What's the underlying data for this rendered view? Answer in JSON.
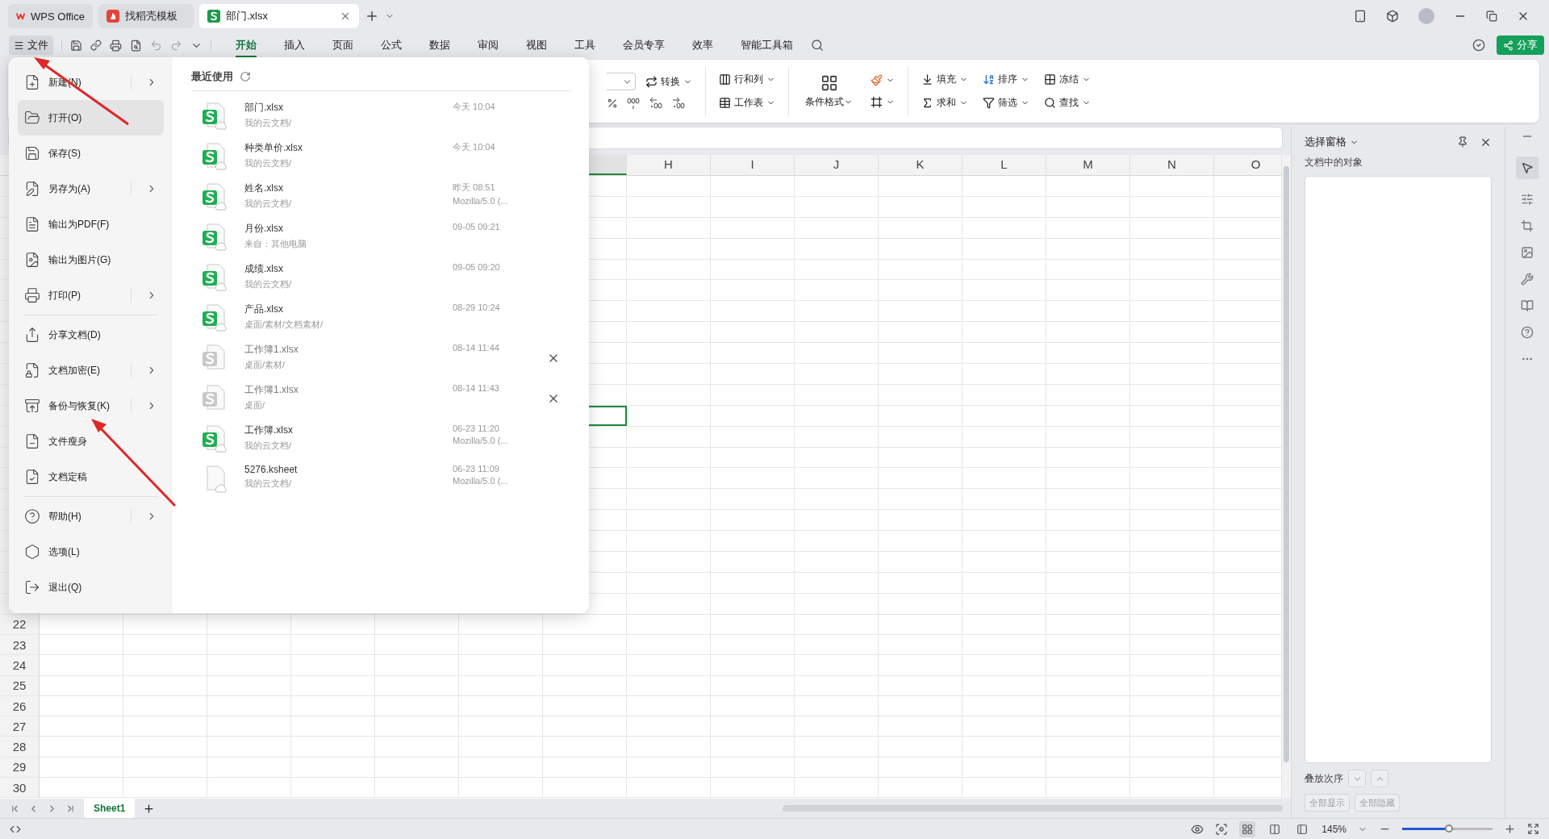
{
  "app_tabs": [
    {
      "label": "WPS Office",
      "kind": "home",
      "selected": false
    },
    {
      "label": "找稻壳模板",
      "kind": "template",
      "selected": false
    },
    {
      "label": "部门.xlsx",
      "kind": "sheet",
      "selected": true
    }
  ],
  "file_button": "文件",
  "ribbon_tabs": [
    {
      "label": "开始",
      "selected": true
    },
    {
      "label": "插入",
      "selected": false
    },
    {
      "label": "页面",
      "selected": false
    },
    {
      "label": "公式",
      "selected": false
    },
    {
      "label": "数据",
      "selected": false
    },
    {
      "label": "审阅",
      "selected": false
    },
    {
      "label": "视图",
      "selected": false
    },
    {
      "label": "工具",
      "selected": false
    },
    {
      "label": "会员专享",
      "selected": false
    },
    {
      "label": "效率",
      "selected": false
    },
    {
      "label": "智能工具箱",
      "selected": false
    }
  ],
  "share_button": "分享",
  "ribbon": {
    "convert": "转换",
    "rows_cols": "行和列",
    "worksheet": "工作表",
    "cond_format": "条件格式",
    "fill": "填充",
    "sort": "排序",
    "freeze": "冻结",
    "sum": "求和",
    "filter": "筛选",
    "find": "查找"
  },
  "file_menu": {
    "items": [
      {
        "label": "新建(N)",
        "kind": "new",
        "submenu": true,
        "selected": false,
        "divider_after": false
      },
      {
        "label": "打开(O)",
        "kind": "open",
        "submenu": false,
        "selected": true,
        "divider_after": false
      },
      {
        "label": "保存(S)",
        "kind": "save",
        "submenu": false,
        "selected": false,
        "divider_after": false
      },
      {
        "label": "另存为(A)",
        "kind": "save_as",
        "submenu": true,
        "selected": false,
        "divider_after": false
      },
      {
        "label": "输出为PDF(F)",
        "kind": "pdf",
        "submenu": false,
        "selected": false,
        "divider_after": false
      },
      {
        "label": "输出为图片(G)",
        "kind": "image",
        "submenu": false,
        "selected": false,
        "divider_after": false
      },
      {
        "label": "打印(P)",
        "kind": "print",
        "submenu": true,
        "selected": false,
        "divider_after": true
      },
      {
        "label": "分享文档(D)",
        "kind": "share",
        "submenu": false,
        "selected": false,
        "divider_after": false
      },
      {
        "label": "文档加密(E)",
        "kind": "encrypt",
        "submenu": true,
        "selected": false,
        "divider_after": false
      },
      {
        "label": "备份与恢复(K)",
        "kind": "backup",
        "submenu": true,
        "selected": false,
        "divider_after": false
      },
      {
        "label": "文件瘦身",
        "kind": "slim",
        "submenu": false,
        "selected": false,
        "divider_after": false
      },
      {
        "label": "文档定稿",
        "kind": "finalize",
        "submenu": false,
        "selected": false,
        "divider_after": true
      },
      {
        "label": "帮助(H)",
        "kind": "help",
        "submenu": true,
        "selected": false,
        "divider_after": false
      },
      {
        "label": "选项(L)",
        "kind": "options",
        "submenu": false,
        "selected": false,
        "divider_after": false
      },
      {
        "label": "退出(Q)",
        "kind": "exit",
        "submenu": false,
        "selected": false,
        "divider_after": false
      }
    ],
    "recent_title": "最近使用",
    "recent_files": [
      {
        "name": "部门.xlsx",
        "path": "我的云文档/",
        "time": "今天  10:04",
        "kind": "sheet",
        "removable": false
      },
      {
        "name": "种类单价.xlsx",
        "path": "我的云文档/",
        "time": "今天  10:04",
        "kind": "sheet",
        "removable": false
      },
      {
        "name": "姓名.xlsx",
        "path": "我的云文档/",
        "time": "昨天  08:51",
        "source": "Mozilla/5.0 (...",
        "kind": "sheet",
        "removable": false
      },
      {
        "name": "月份.xlsx",
        "path": "来自：其他电脑",
        "time": "09-05 09:21",
        "kind": "sheet",
        "removable": false
      },
      {
        "name": "成绩.xlsx",
        "path": "我的云文档/",
        "time": "09-05 09:20",
        "kind": "sheet",
        "removable": false
      },
      {
        "name": "产品.xlsx",
        "path": "桌面/素材/文档素材/",
        "time": "08-29 10:24",
        "kind": "sheet",
        "removable": false
      },
      {
        "name": "工作簿1.xlsx",
        "path": "桌面/素材/",
        "time": "08-14 11:44",
        "kind": "unavailable",
        "removable": true
      },
      {
        "name": "工作簿1.xlsx",
        "path": "桌面/",
        "time": "08-14 11:43",
        "kind": "unavailable",
        "removable": true
      },
      {
        "name": "工作簿.xlsx",
        "path": "我的云文档/",
        "time": "06-23 11:20",
        "source": "Mozilla/5.0 (...",
        "kind": "sheet",
        "removable": false
      },
      {
        "name": "5276.ksheet",
        "path": "我的云文档/",
        "time": "06-23 11:09",
        "source": "Mozilla/5.0 (...",
        "kind": "generic",
        "removable": false
      }
    ]
  },
  "columns": [
    "H",
    "I",
    "J",
    "K",
    "L",
    "M",
    "N",
    "O"
  ],
  "row_numbers": [
    "22",
    "23",
    "24",
    "25",
    "26",
    "27",
    "28",
    "29",
    "30"
  ],
  "sheet_tabs": [
    {
      "label": "Sheet1",
      "selected": true
    }
  ],
  "selection_pane": {
    "title": "选择窗格",
    "subtitle": "文档中的对象",
    "order_label": "叠放次序",
    "buttons": [
      "全部显示",
      "全部隐藏"
    ]
  },
  "zoom": {
    "reading": "145%",
    "level": 0.52
  }
}
